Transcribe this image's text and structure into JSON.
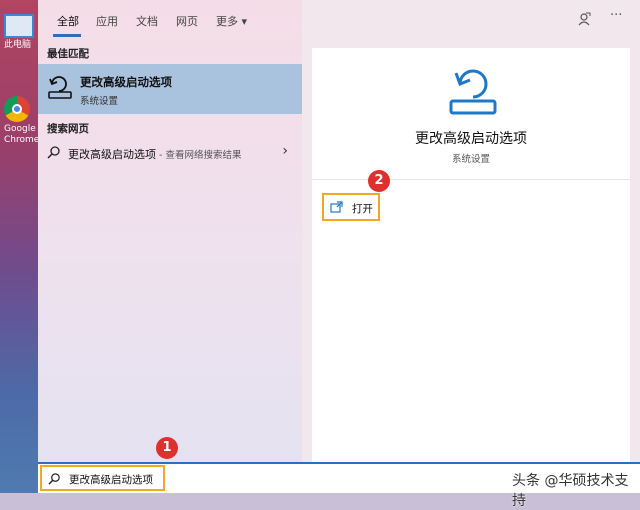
{
  "desktop": {
    "icons": [
      {
        "label": "此电脑"
      },
      {
        "label": "Google Chrome"
      }
    ]
  },
  "tabs": [
    {
      "label": "全部",
      "active": true
    },
    {
      "label": "应用"
    },
    {
      "label": "文档"
    },
    {
      "label": "网页"
    },
    {
      "label": "更多 ▾"
    }
  ],
  "header_icons": [
    "feedback-icon",
    "more-options-icon"
  ],
  "best_match": {
    "section_title": "最佳匹配",
    "title": "更改高级启动选项",
    "subtitle": "系统设置",
    "icon": "restore-drive-icon"
  },
  "web_search": {
    "section_title": "搜索网页",
    "query": "更改高级启动选项",
    "hint": " - 查看网络搜索结果",
    "chevron": "›"
  },
  "detail": {
    "title": "更改高级启动选项",
    "subtitle": "系统设置",
    "actions": [
      {
        "label": "打开",
        "icon": "open-window-icon"
      }
    ]
  },
  "search": {
    "value": "更改高级启动选项",
    "icon": "search-icon"
  },
  "badges": [
    "1",
    "2"
  ],
  "watermark": "头条 @华硕技术支持",
  "colors": {
    "accent": "#2b6fbe",
    "highlight": "#f5a623",
    "badge": "#e02f2f",
    "selected_row": "#a9c2de"
  }
}
